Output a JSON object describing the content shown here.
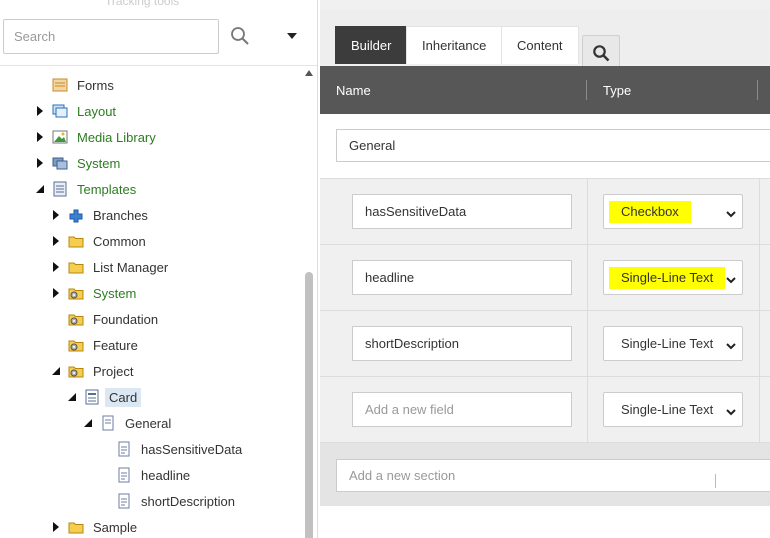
{
  "tree_panel": {
    "faded_top_text": "Tracking tools",
    "search": {
      "placeholder": "Search"
    },
    "icons": {
      "search": "search-icon",
      "dropdown": "caret-down-icon"
    },
    "items": [
      {
        "label": "Forms",
        "color": "dark",
        "icon": "forms-icon",
        "arrow": "none"
      },
      {
        "label": "Layout",
        "color": "green",
        "icon": "layout-icon",
        "arrow": "collapsed"
      },
      {
        "label": "Media Library",
        "color": "green",
        "icon": "media-library-icon",
        "arrow": "collapsed"
      },
      {
        "label": "System",
        "color": "green",
        "icon": "system-icon",
        "arrow": "collapsed"
      },
      {
        "label": "Templates",
        "color": "green",
        "icon": "templates-icon",
        "arrow": "expanded"
      },
      {
        "label": "Branches",
        "color": "dark",
        "icon": "branches-icon",
        "arrow": "collapsed"
      },
      {
        "label": "Common",
        "color": "dark",
        "icon": "folder-icon",
        "arrow": "collapsed"
      },
      {
        "label": "List Manager",
        "color": "dark",
        "icon": "folder-icon",
        "arrow": "collapsed"
      },
      {
        "label": "System",
        "color": "green",
        "icon": "folder-gear-icon",
        "arrow": "collapsed"
      },
      {
        "label": "Foundation",
        "color": "dark",
        "icon": "folder-gear-icon",
        "arrow": "none"
      },
      {
        "label": "Feature",
        "color": "dark",
        "icon": "folder-gear-icon",
        "arrow": "none"
      },
      {
        "label": "Project",
        "color": "dark",
        "icon": "folder-gear-icon",
        "arrow": "expanded"
      },
      {
        "label": "Card",
        "color": "dark",
        "icon": "template-icon",
        "arrow": "expanded",
        "selected": true
      },
      {
        "label": "General",
        "color": "dark",
        "icon": "section-icon",
        "arrow": "expanded"
      },
      {
        "label": "hasSensitiveData",
        "color": "dark",
        "icon": "field-icon",
        "arrow": "none"
      },
      {
        "label": "headline",
        "color": "dark",
        "icon": "field-icon",
        "arrow": "none"
      },
      {
        "label": "shortDescription",
        "color": "dark",
        "icon": "field-icon",
        "arrow": "none"
      },
      {
        "label": "Sample",
        "color": "dark",
        "icon": "folder-icon",
        "arrow": "collapsed"
      }
    ]
  },
  "builder": {
    "tabs": [
      {
        "label": "Builder",
        "active": true
      },
      {
        "label": "Inheritance",
        "active": false
      },
      {
        "label": "Content",
        "active": false
      }
    ],
    "search_icon": "search-icon",
    "columns": {
      "name": "Name",
      "type": "Type"
    },
    "section_name": "General",
    "fields": [
      {
        "name": "hasSensitiveData",
        "type": "Checkbox",
        "highlighted": true,
        "placeholder": false
      },
      {
        "name": "headline",
        "type": "Single-Line Text",
        "highlighted": true,
        "placeholder": false
      },
      {
        "name": "shortDescription",
        "type": "Single-Line Text",
        "highlighted": false,
        "placeholder": false
      },
      {
        "name": "Add a new field",
        "type": "Single-Line Text",
        "highlighted": false,
        "placeholder": true
      }
    ],
    "add_section_placeholder": "Add a new section",
    "highlight_color": "#ffff00",
    "header_color": "#575757",
    "active_tab_color": "#3c3c3c"
  }
}
